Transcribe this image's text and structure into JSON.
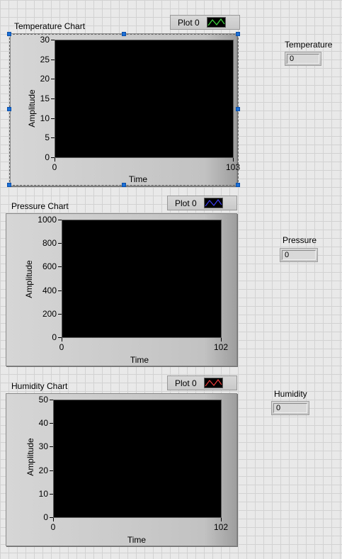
{
  "charts": [
    {
      "id": "temperature",
      "title": "Temperature Chart",
      "legend_plot": "Plot 0",
      "legend_color": "#3dd13d",
      "chart_data": {
        "type": "line",
        "title": "Temperature Chart",
        "xlabel": "Time",
        "ylabel": "Amplitude",
        "x_min_label": "0",
        "x_max_label": "103",
        "xlim": [
          0,
          103
        ],
        "ylim": [
          0,
          30
        ],
        "y_ticks": [
          "30",
          "25",
          "20",
          "15",
          "10",
          "5",
          "0"
        ],
        "series": [
          {
            "name": "Plot 0",
            "values": []
          }
        ]
      }
    },
    {
      "id": "pressure",
      "title": "Pressure Chart",
      "legend_plot": "Plot 0",
      "legend_color": "#3a3ae6",
      "chart_data": {
        "type": "line",
        "title": "Pressure Chart",
        "xlabel": "Time",
        "ylabel": "Amplitude",
        "x_min_label": "0",
        "x_max_label": "102",
        "xlim": [
          0,
          102
        ],
        "ylim": [
          0,
          1000
        ],
        "y_ticks": [
          "1000",
          "800",
          "600",
          "400",
          "200",
          "0"
        ],
        "series": [
          {
            "name": "Plot 0",
            "values": []
          }
        ]
      }
    },
    {
      "id": "humidity",
      "title": "Humidity Chart",
      "legend_plot": "Plot 0",
      "legend_color": "#e03a3a",
      "chart_data": {
        "type": "line",
        "title": "Humidity Chart",
        "xlabel": "Time",
        "ylabel": "Amplitude",
        "x_min_label": "0",
        "x_max_label": "102",
        "xlim": [
          0,
          102
        ],
        "ylim": [
          0,
          50
        ],
        "y_ticks": [
          "50",
          "40",
          "30",
          "20",
          "10",
          "0"
        ],
        "series": [
          {
            "name": "Plot 0",
            "values": []
          }
        ]
      }
    }
  ],
  "indicators": [
    {
      "id": "temperature",
      "label": "Temperature",
      "value": "0"
    },
    {
      "id": "pressure",
      "label": "Pressure",
      "value": "0"
    },
    {
      "id": "humidity",
      "label": "Humidity",
      "value": "0"
    }
  ],
  "selection": {
    "selected_chart": "temperature"
  }
}
